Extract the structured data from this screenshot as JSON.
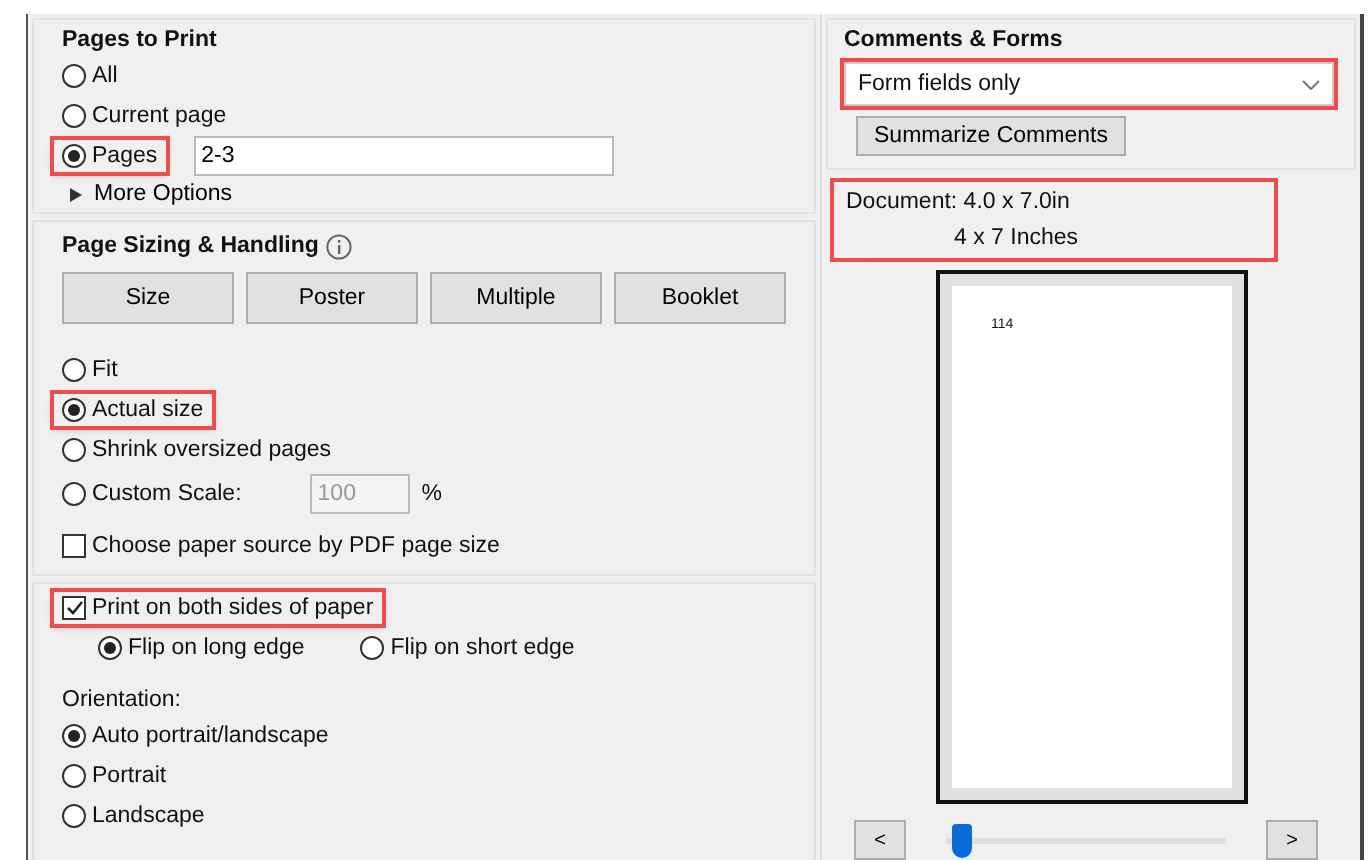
{
  "pages_to_print": {
    "title": "Pages to Print",
    "options": [
      {
        "label": "All",
        "selected": false,
        "highlighted": false
      },
      {
        "label": "Current page",
        "selected": false,
        "highlighted": false
      },
      {
        "label": "Pages",
        "selected": true,
        "highlighted": true,
        "value": "2-3"
      }
    ],
    "more_options": {
      "label": "More Options",
      "expanded": false
    }
  },
  "page_sizing": {
    "title": "Page Sizing & Handling",
    "buttons": [
      "Size",
      "Poster",
      "Multiple",
      "Booklet"
    ],
    "options": [
      {
        "label": "Fit",
        "selected": false,
        "highlighted": false
      },
      {
        "label": "Actual size",
        "selected": true,
        "highlighted": true
      },
      {
        "label": "Shrink oversized pages",
        "selected": false,
        "highlighted": false
      },
      {
        "label": "Custom Scale:",
        "selected": false,
        "highlighted": false,
        "value": "100",
        "disabled": true,
        "unit": "%"
      }
    ],
    "paper_source": {
      "label": "Choose paper source by PDF page size",
      "checked": false
    }
  },
  "duplex": {
    "both_sides": {
      "label": "Print on both sides of paper",
      "checked": true,
      "highlighted": true
    },
    "flip": [
      {
        "label": "Flip on long edge",
        "selected": true
      },
      {
        "label": "Flip on short edge",
        "selected": false
      }
    ],
    "orientation_label": "Orientation:",
    "orientation": [
      {
        "label": "Auto portrait/landscape",
        "selected": true
      },
      {
        "label": "Portrait",
        "selected": false
      },
      {
        "label": "Landscape",
        "selected": false
      }
    ]
  },
  "comments_forms": {
    "title": "Comments & Forms",
    "value": "Form fields only",
    "highlighted": true,
    "button": "Summarize Comments"
  },
  "preview": {
    "document": "Document: 4.0 x 7.0in",
    "size": "4 x 7 Inches",
    "highlighted": true,
    "page_number": "114",
    "nav": [
      "<",
      ">"
    ],
    "level": 0.02
  }
}
